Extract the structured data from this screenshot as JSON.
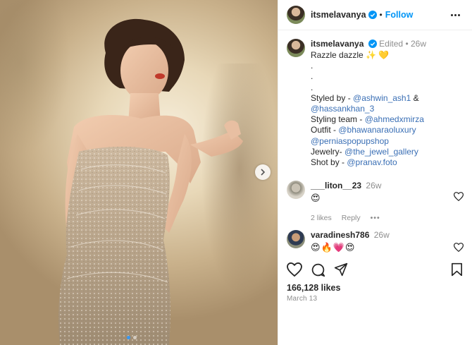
{
  "post": {
    "author": "itsmelavanya",
    "follow_label": "Follow",
    "caption": {
      "edited": "Edited",
      "age": "26w",
      "lines": [
        {
          "type": "text",
          "value": "Razzle dazzle ✨ 💛"
        },
        {
          "type": "text",
          "value": "."
        },
        {
          "type": "text",
          "value": "."
        },
        {
          "type": "text",
          "value": "."
        },
        {
          "type": "mixed",
          "prefix": "Styled by - ",
          "link": "@ashwin_ash1",
          "suffix": " &"
        },
        {
          "type": "mixed",
          "prefix": "",
          "link": "@hassankhan_3",
          "suffix": ""
        },
        {
          "type": "mixed",
          "prefix": "Styling team - ",
          "link": "@ahmedxmirza",
          "suffix": ""
        },
        {
          "type": "mixed",
          "prefix": "Outfit - ",
          "link": "@bhawanaraoluxury",
          "suffix": ""
        },
        {
          "type": "mixed",
          "prefix": "",
          "link": "@perniaspopupshop",
          "suffix": ""
        },
        {
          "type": "mixed",
          "prefix": "Jewelry- ",
          "link": "@the_jewel_gallery",
          "suffix": ""
        },
        {
          "type": "mixed",
          "prefix": "Shot by - ",
          "link": "@pranav.foto",
          "suffix": ""
        }
      ]
    },
    "comments": [
      {
        "user": "___liton__23",
        "time": "26w",
        "text": "😍",
        "likes": "2 likes",
        "reply": "Reply",
        "options": "•••"
      },
      {
        "user": "varadinesh786",
        "time": "26w",
        "text": "😍🔥💗😍"
      }
    ],
    "likes_count": "166,128 likes",
    "date": "March 13"
  },
  "colors": {
    "accent": "#0095f6",
    "link": "#3a6fb5",
    "muted": "#8e8e8e"
  },
  "icons": {
    "verified": "verified-badge-icon",
    "more": "more-options-icon",
    "next": "chevron-right-icon",
    "like": "heart-icon",
    "comment": "comment-bubble-icon",
    "share": "paper-plane-icon",
    "save": "bookmark-icon"
  }
}
